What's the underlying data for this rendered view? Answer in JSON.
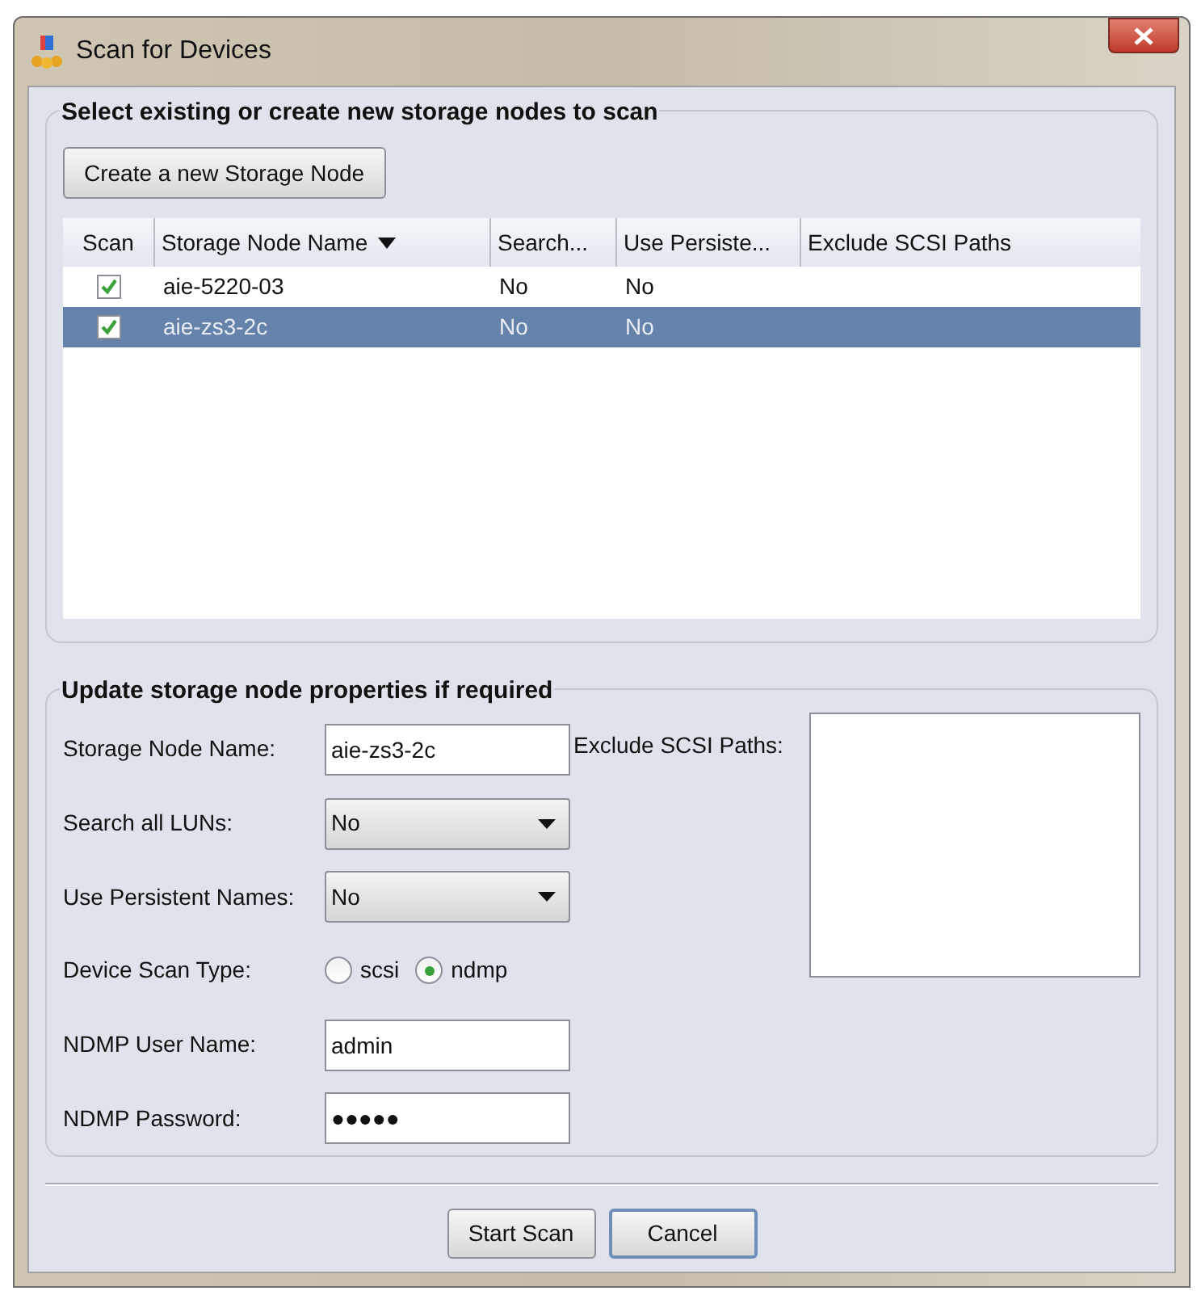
{
  "window": {
    "title": "Scan for Devices"
  },
  "nodes_group": {
    "title": "Select existing or create new storage nodes to scan",
    "create_button": "Create a new Storage Node"
  },
  "table": {
    "columns": [
      {
        "label": "Scan",
        "sorted": false
      },
      {
        "label": "Storage Node Name",
        "sorted": true
      },
      {
        "label": "Search...",
        "sorted": false
      },
      {
        "label": "Use Persiste...",
        "sorted": false
      },
      {
        "label": "Exclude SCSI Paths",
        "sorted": false
      }
    ],
    "rows": [
      {
        "checked": true,
        "name": "aie-5220-03",
        "search": "No",
        "persistent": "No",
        "selected": false
      },
      {
        "checked": true,
        "name": "aie-zs3-2c",
        "search": "No",
        "persistent": "No",
        "selected": true
      }
    ]
  },
  "props_group": {
    "title": "Update storage node properties if required",
    "node_name": {
      "label": "Storage Node Name:",
      "value": "aie-zs3-2c"
    },
    "search_luns": {
      "label": "Search all LUNs:",
      "value": "No"
    },
    "persistent_names": {
      "label": "Use Persistent Names:",
      "value": "No"
    },
    "scan_type": {
      "label": "Device Scan Type:",
      "options": [
        {
          "label": "scsi",
          "selected": false
        },
        {
          "label": "ndmp",
          "selected": true
        }
      ]
    },
    "ndmp_user": {
      "label": "NDMP User Name:",
      "value": "admin"
    },
    "ndmp_password": {
      "label": "NDMP Password:",
      "value": "●●●●●"
    },
    "exclude_paths": {
      "label": "Exclude SCSI Paths:"
    }
  },
  "buttons": [
    {
      "label": "Start Scan",
      "default": false
    },
    {
      "label": "Cancel",
      "default": true
    }
  ]
}
